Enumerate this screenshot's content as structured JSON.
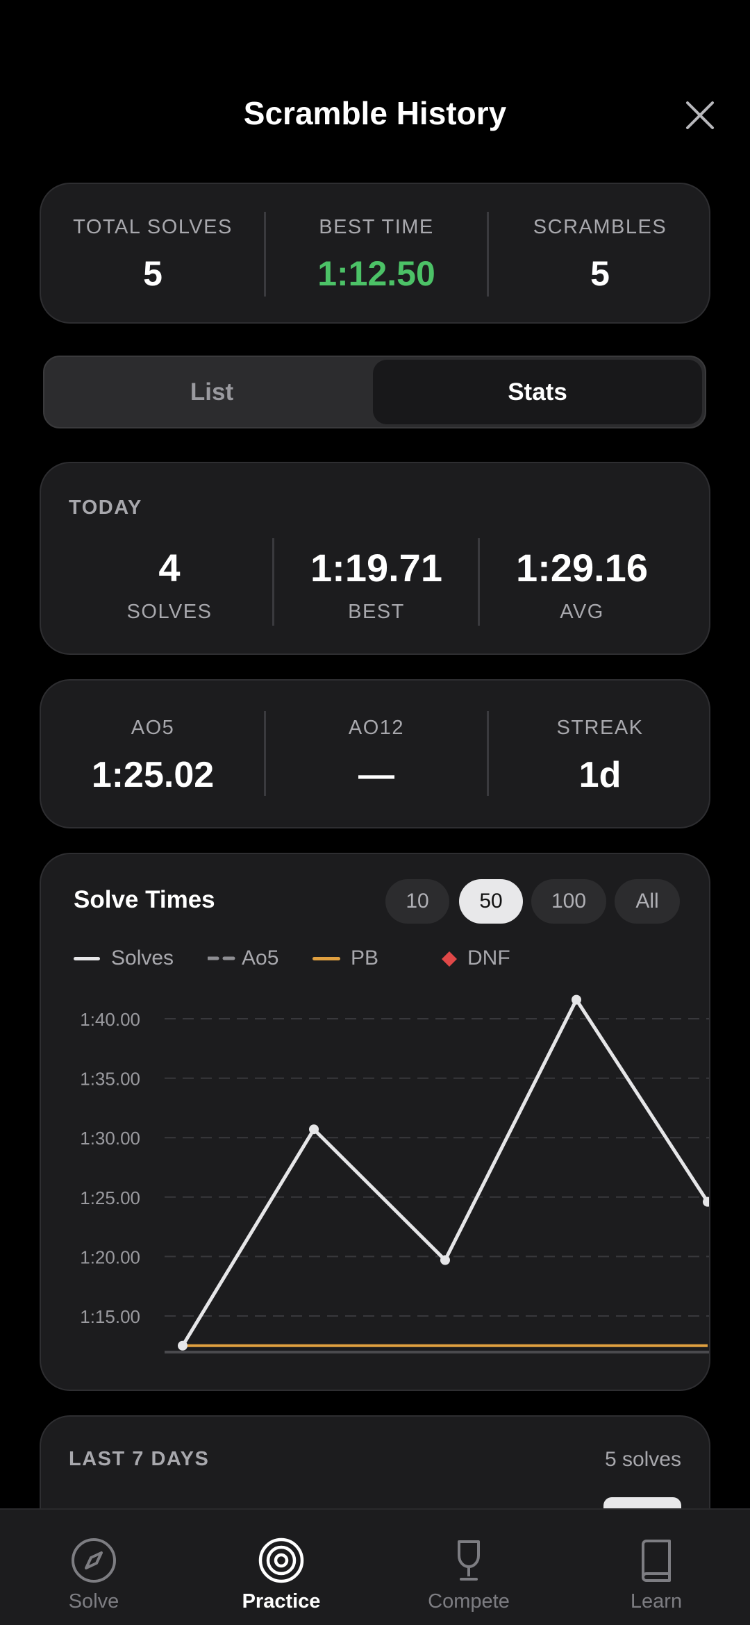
{
  "header": {
    "title": "Scramble History"
  },
  "summary": [
    {
      "label": "TOTAL SOLVES",
      "value": "5",
      "color": "#ffffff"
    },
    {
      "label": "BEST TIME",
      "value": "1:12.50",
      "color": "#4cc267"
    },
    {
      "label": "SCRAMBLES",
      "value": "5",
      "color": "#ffffff"
    }
  ],
  "view_toggle": {
    "list": "List",
    "stats": "Stats",
    "selected": "Stats"
  },
  "today": {
    "title": "TODAY",
    "items": [
      {
        "value": "4",
        "label": "SOLVES"
      },
      {
        "value": "1:19.71",
        "label": "BEST"
      },
      {
        "value": "1:29.16",
        "label": "AVG"
      }
    ]
  },
  "averages": [
    {
      "label": "AO5",
      "value": "1:25.02"
    },
    {
      "label": "AO12",
      "value": "—"
    },
    {
      "label": "STREAK",
      "value": "1d"
    }
  ],
  "chart_panel": {
    "title": "Solve Times",
    "range_options": [
      "10",
      "50",
      "100",
      "All"
    ],
    "selected_range": "50",
    "legend": [
      {
        "name": "Solves",
        "style": "solid",
        "color": "#e6e6e8"
      },
      {
        "name": "Ao5",
        "style": "dashed",
        "color": "#8e8e93"
      },
      {
        "name": "PB",
        "style": "solid",
        "color": "#e0a040"
      },
      {
        "name": "DNF",
        "style": "diamond",
        "color": "#e04848"
      }
    ]
  },
  "chart_data": {
    "type": "line",
    "y_tick_labels": [
      "1:40.00",
      "1:35.00",
      "1:30.00",
      "1:25.00",
      "1:20.00",
      "1:15.00"
    ],
    "y_ticks_seconds": [
      100,
      95,
      90,
      85,
      80,
      75
    ],
    "ylim_seconds": [
      72.5,
      102
    ],
    "grid": true,
    "series": [
      {
        "name": "Solves",
        "values_seconds": [
          72.5,
          90.7,
          79.7,
          101.6,
          84.6
        ],
        "color": "#e6e6e8"
      },
      {
        "name": "PB",
        "values_seconds": [
          72.5,
          72.5,
          72.5,
          72.5,
          72.5
        ],
        "color": "#e0a040"
      }
    ]
  },
  "last7": {
    "title": "LAST 7 DAYS",
    "count": "5 solves"
  },
  "tabs": [
    {
      "label": "Solve",
      "icon": "compass-icon",
      "active": false
    },
    {
      "label": "Practice",
      "icon": "target-icon",
      "active": true
    },
    {
      "label": "Compete",
      "icon": "trophy-icon",
      "active": false
    },
    {
      "label": "Learn",
      "icon": "book-icon",
      "active": false
    }
  ]
}
